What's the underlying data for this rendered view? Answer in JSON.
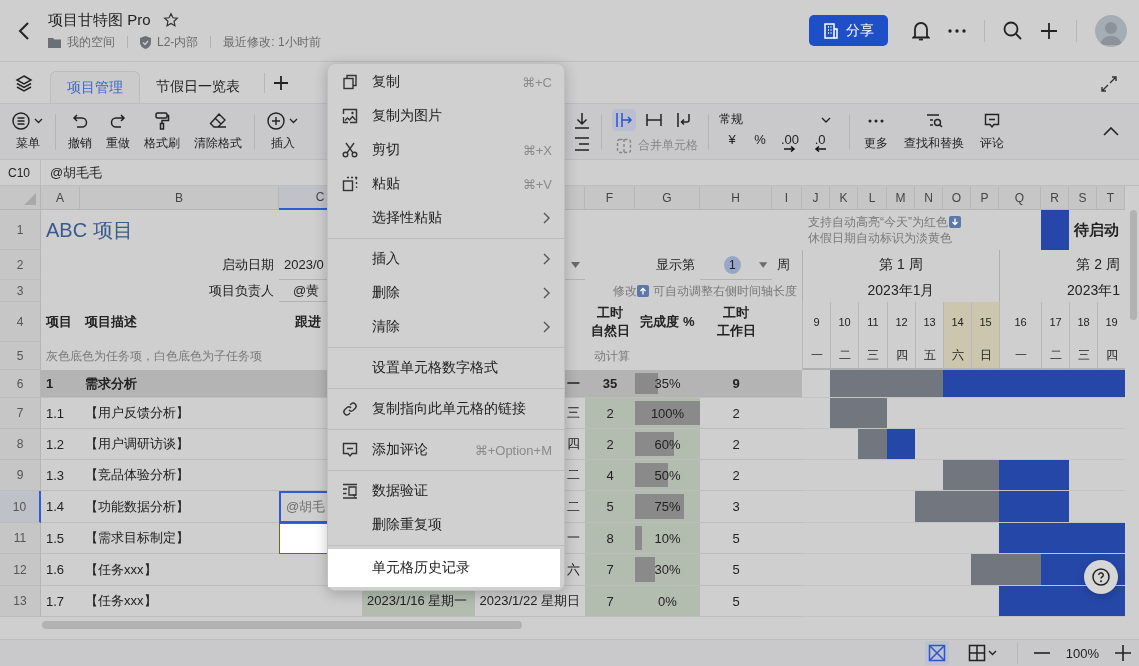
{
  "header": {
    "title": "项目甘特图 Pro",
    "starred": false,
    "breadcrumb": [
      "我的空间",
      "L2-内部",
      "最近修改: 1小时前"
    ],
    "share_label": "分享"
  },
  "tabs": [
    {
      "label": "项目管理",
      "selected": true
    },
    {
      "label": "节假日一览表",
      "selected": false
    }
  ],
  "toolbar": {
    "left_groups": [
      [
        {
          "label": "菜单",
          "dropdown": true
        }
      ],
      [
        {
          "label": "撤销",
          "dropdown": false
        },
        {
          "label": "重做",
          "dropdown": false
        },
        {
          "label": "格式刷",
          "dropdown": false
        },
        {
          "label": "清除格式",
          "dropdown": false
        }
      ],
      [
        {
          "label": "插入",
          "dropdown": true
        }
      ]
    ],
    "align_buttons": [
      {
        "selected": true
      },
      {
        "selected": false
      },
      {
        "selected": false
      }
    ],
    "merge": {
      "label": "合并单元格",
      "disabled": true
    },
    "number_format": "常规",
    "number_buttons": [
      {
        "kind": "text",
        "label": "¥"
      },
      {
        "kind": "text",
        "label": "%"
      },
      {
        "kind": "increase",
        "label": ".00"
      },
      {
        "kind": "decrease",
        "label": ".0"
      }
    ],
    "right": [
      "更多",
      "查找和替换",
      "评论"
    ]
  },
  "formula_bar": {
    "cell": "C10",
    "value": "@胡毛毛"
  },
  "sheet": {
    "columns": [
      {
        "label": "A",
        "selected": false
      },
      {
        "label": "B",
        "selected": false
      },
      {
        "label": "C",
        "selected": true
      },
      {
        "label": "F",
        "selected": false
      },
      {
        "label": "G",
        "selected": false
      },
      {
        "label": "H",
        "selected": false
      },
      {
        "label": "I",
        "selected": false
      },
      {
        "label": "J",
        "selected": false
      },
      {
        "label": "K",
        "selected": false
      },
      {
        "label": "L",
        "selected": false
      },
      {
        "label": "M",
        "selected": false
      },
      {
        "label": "N",
        "selected": false
      },
      {
        "label": "O",
        "selected": false
      },
      {
        "label": "P",
        "selected": false
      },
      {
        "label": "Q",
        "selected": false
      },
      {
        "label": "R",
        "selected": false
      },
      {
        "label": "S",
        "selected": false
      },
      {
        "label": "T",
        "selected": false
      }
    ],
    "top_row_numbers": [
      "1",
      "2",
      "3",
      "4",
      "5"
    ],
    "title": "ABC 项目",
    "notes": [
      "支持自动高亮“今天”为红色",
      "休假日期自动标识为淡黄色"
    ],
    "legend": {
      "label": "待启动"
    },
    "start_label": "启动日期",
    "start_value": "2023/0",
    "owner_label": "项目负责人",
    "owner_value": "@黄",
    "week_selector": {
      "prefix": "显示第",
      "value": "1",
      "suffix": "周"
    },
    "timeline_note": {
      "prefix": "修改",
      "text": "可自动调整右侧时间轴长度"
    },
    "headers": {
      "id": "项目",
      "desc": "项目描述",
      "owner": "跟进",
      "days": [
        "工时",
        "自然日"
      ],
      "percent": "完成度 %",
      "workdays": [
        "工时",
        "工作日"
      ]
    },
    "hint": "灰色底色为任务项，白色底色为子任务项",
    "calc_note": "动计算",
    "weeks": [
      {
        "label": "第 1 周",
        "month": "2023年1月"
      },
      {
        "label": "第 2 周",
        "month": "2023年1"
      }
    ],
    "days": [
      {
        "date": "9",
        "weekday": "一",
        "holiday": false
      },
      {
        "date": "10",
        "weekday": "二",
        "holiday": false
      },
      {
        "date": "11",
        "weekday": "三",
        "holiday": false
      },
      {
        "date": "12",
        "weekday": "四",
        "holiday": false
      },
      {
        "date": "13",
        "weekday": "五",
        "holiday": false
      },
      {
        "date": "14",
        "weekday": "六",
        "holiday": true
      },
      {
        "date": "15",
        "weekday": "日",
        "holiday": true
      },
      {
        "date": "16",
        "weekday": "一",
        "holiday": false
      },
      {
        "date": "17",
        "weekday": "二",
        "holiday": false
      },
      {
        "date": "18",
        "weekday": "三",
        "holiday": false
      },
      {
        "date": "19",
        "weekday": "四",
        "holiday": false
      }
    ],
    "rows": [
      {
        "number": "6",
        "kind": "task",
        "selected": false,
        "spotlight": false,
        "id": "1",
        "desc": "需求分析",
        "end": "一",
        "days": "35",
        "percent": "35%",
        "level": 0.35,
        "workdays": "9",
        "timeline": [
          {
            "kind": "none"
          },
          {
            "kind": "elapsed"
          },
          {
            "kind": "elapsed"
          },
          {
            "kind": "elapsed"
          },
          {
            "kind": "elapsed"
          },
          {
            "kind": "pending"
          },
          {
            "kind": "pending"
          },
          {
            "kind": "pending"
          },
          {
            "kind": "pending"
          },
          {
            "kind": "pending"
          },
          {
            "kind": "pending"
          }
        ]
      },
      {
        "number": "7",
        "kind": "subtask",
        "selected": false,
        "spotlight": false,
        "id": "1.1",
        "desc": "【用户反馈分析】",
        "end": "三",
        "days": "2",
        "percent": "100%",
        "level": 1,
        "workdays": "2",
        "timeline": [
          {
            "kind": "none"
          },
          {
            "kind": "elapsed"
          },
          {
            "kind": "elapsed"
          },
          {
            "kind": "none"
          },
          {
            "kind": "none"
          },
          {
            "kind": "none"
          },
          {
            "kind": "none"
          },
          {
            "kind": "none"
          },
          {
            "kind": "none"
          },
          {
            "kind": "none"
          },
          {
            "kind": "none"
          }
        ]
      },
      {
        "number": "8",
        "kind": "subtask",
        "selected": false,
        "spotlight": false,
        "id": "1.2",
        "desc": "【用户调研访谈】",
        "end": "四",
        "days": "2",
        "percent": "60%",
        "level": 0.6,
        "workdays": "2",
        "timeline": [
          {
            "kind": "none"
          },
          {
            "kind": "none"
          },
          {
            "kind": "elapsed"
          },
          {
            "kind": "pending"
          },
          {
            "kind": "none"
          },
          {
            "kind": "none"
          },
          {
            "kind": "none"
          },
          {
            "kind": "none"
          },
          {
            "kind": "none"
          },
          {
            "kind": "none"
          },
          {
            "kind": "none"
          }
        ]
      },
      {
        "number": "9",
        "kind": "subtask",
        "selected": false,
        "spotlight": false,
        "id": "1.3",
        "desc": "【竞品体验分析】",
        "end": "二",
        "days": "4",
        "percent": "50%",
        "level": 0.5,
        "workdays": "2",
        "timeline": [
          {
            "kind": "none"
          },
          {
            "kind": "none"
          },
          {
            "kind": "none"
          },
          {
            "kind": "none"
          },
          {
            "kind": "none"
          },
          {
            "kind": "elapsed"
          },
          {
            "kind": "elapsed"
          },
          {
            "kind": "pending"
          },
          {
            "kind": "pending"
          },
          {
            "kind": "none"
          },
          {
            "kind": "none"
          }
        ]
      },
      {
        "number": "10",
        "kind": "subtask",
        "selected": true,
        "spotlight": false,
        "id": "1.4",
        "desc": "【功能数据分析】",
        "owner": "@胡毛",
        "end": "二",
        "days": "5",
        "percent": "75%",
        "level": 0.75,
        "workdays": "3",
        "timeline": [
          {
            "kind": "none"
          },
          {
            "kind": "none"
          },
          {
            "kind": "none"
          },
          {
            "kind": "none"
          },
          {
            "kind": "elapsed"
          },
          {
            "kind": "elapsed"
          },
          {
            "kind": "elapsed"
          },
          {
            "kind": "pending"
          },
          {
            "kind": "pending"
          },
          {
            "kind": "none"
          },
          {
            "kind": "none"
          }
        ]
      },
      {
        "number": "11",
        "kind": "subtask",
        "selected": false,
        "spotlight": true,
        "id": "1.5",
        "desc": "【需求目标制定】",
        "end": "一",
        "days": "8",
        "percent": "10%",
        "level": 0.1,
        "workdays": "5",
        "timeline": [
          {
            "kind": "none"
          },
          {
            "kind": "none"
          },
          {
            "kind": "none"
          },
          {
            "kind": "none"
          },
          {
            "kind": "none"
          },
          {
            "kind": "none"
          },
          {
            "kind": "none"
          },
          {
            "kind": "pending"
          },
          {
            "kind": "pending"
          },
          {
            "kind": "pending"
          },
          {
            "kind": "pending"
          }
        ]
      },
      {
        "number": "12",
        "kind": "subtask",
        "selected": false,
        "spotlight": false,
        "id": "1.6",
        "desc": "【任务xxx】",
        "end": "六",
        "days": "7",
        "percent": "30%",
        "level": 0.3,
        "workdays": "5",
        "timeline": [
          {
            "kind": "none"
          },
          {
            "kind": "none"
          },
          {
            "kind": "none"
          },
          {
            "kind": "none"
          },
          {
            "kind": "none"
          },
          {
            "kind": "none"
          },
          {
            "kind": "elapsed"
          },
          {
            "kind": "elapsed"
          },
          {
            "kind": "pending"
          },
          {
            "kind": "pending"
          },
          {
            "kind": "pending"
          }
        ]
      },
      {
        "number": "13",
        "kind": "subtask",
        "selected": false,
        "spotlight": false,
        "id": "1.7",
        "desc": "【任务xxx】",
        "start": "2023/1/16 星期一",
        "end": "2023/1/22 星期日",
        "days": "7",
        "percent": "0%",
        "level": 0,
        "workdays": "5",
        "timeline": [
          {
            "kind": "none"
          },
          {
            "kind": "none"
          },
          {
            "kind": "none"
          },
          {
            "kind": "none"
          },
          {
            "kind": "none"
          },
          {
            "kind": "none"
          },
          {
            "kind": "none"
          },
          {
            "kind": "pending"
          },
          {
            "kind": "pending"
          },
          {
            "kind": "pending"
          },
          {
            "kind": "pending"
          }
        ]
      }
    ]
  },
  "context_menu": {
    "groups": [
      [
        {
          "label": "复制",
          "shortcut": "⌘+C",
          "submenu": false,
          "highlighted": false
        },
        {
          "label": "复制为图片",
          "submenu": false,
          "highlighted": false
        },
        {
          "label": "剪切",
          "shortcut": "⌘+X",
          "submenu": false,
          "highlighted": false
        },
        {
          "label": "粘贴",
          "shortcut": "⌘+V",
          "submenu": false,
          "highlighted": false
        },
        {
          "label": "选择性粘贴",
          "submenu": true,
          "highlighted": false
        }
      ],
      [
        {
          "label": "插入",
          "submenu": true,
          "highlighted": false
        },
        {
          "label": "删除",
          "submenu": true,
          "highlighted": false
        },
        {
          "label": "清除",
          "submenu": true,
          "highlighted": false
        }
      ],
      [
        {
          "label": "设置单元格数字格式",
          "submenu": false,
          "highlighted": false
        }
      ],
      [
        {
          "label": "复制指向此单元格的链接",
          "submenu": false,
          "highlighted": false
        }
      ],
      [
        {
          "label": "添加评论",
          "shortcut": "⌘+Option+M",
          "submenu": false,
          "highlighted": false
        }
      ],
      [
        {
          "label": "数据验证",
          "submenu": false,
          "highlighted": false
        },
        {
          "label": "删除重复项",
          "submenu": false,
          "highlighted": false
        }
      ],
      [
        {
          "label": "单元格历史记录",
          "submenu": false,
          "highlighted": true
        }
      ]
    ]
  },
  "status_bar": {
    "zoom": "100%"
  }
}
